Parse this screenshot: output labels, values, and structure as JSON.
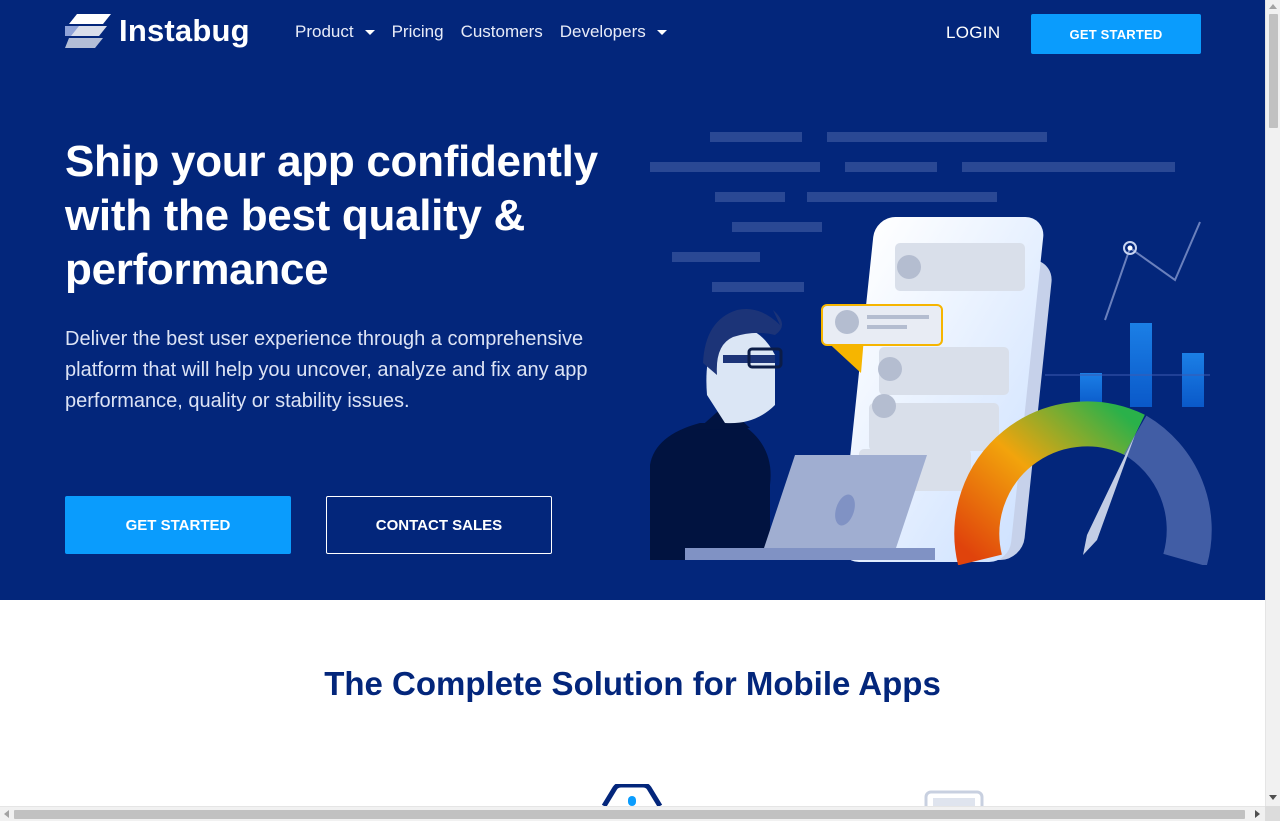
{
  "brand": {
    "name": "Instabug"
  },
  "nav": {
    "items": [
      {
        "label": "Product",
        "has_dropdown": true
      },
      {
        "label": "Pricing",
        "has_dropdown": false
      },
      {
        "label": "Customers",
        "has_dropdown": false
      },
      {
        "label": "Developers",
        "has_dropdown": true
      }
    ],
    "login_label": "LOGIN",
    "get_started_label": "GET STARTED"
  },
  "hero": {
    "headline": "Ship your app confidently with the best quality & performance",
    "subheadline": "Deliver the best user experience through a comprehensive platform that will help you uncover, analyze and fix any app performance, quality or stability issues.",
    "primary_cta": "GET STARTED",
    "secondary_cta": "CONTACT SALES"
  },
  "section": {
    "title": "The Complete Solution for Mobile Apps"
  },
  "colors": {
    "hero_bg": "#03267b",
    "accent": "#0a9cfd",
    "heading": "#03267b"
  }
}
